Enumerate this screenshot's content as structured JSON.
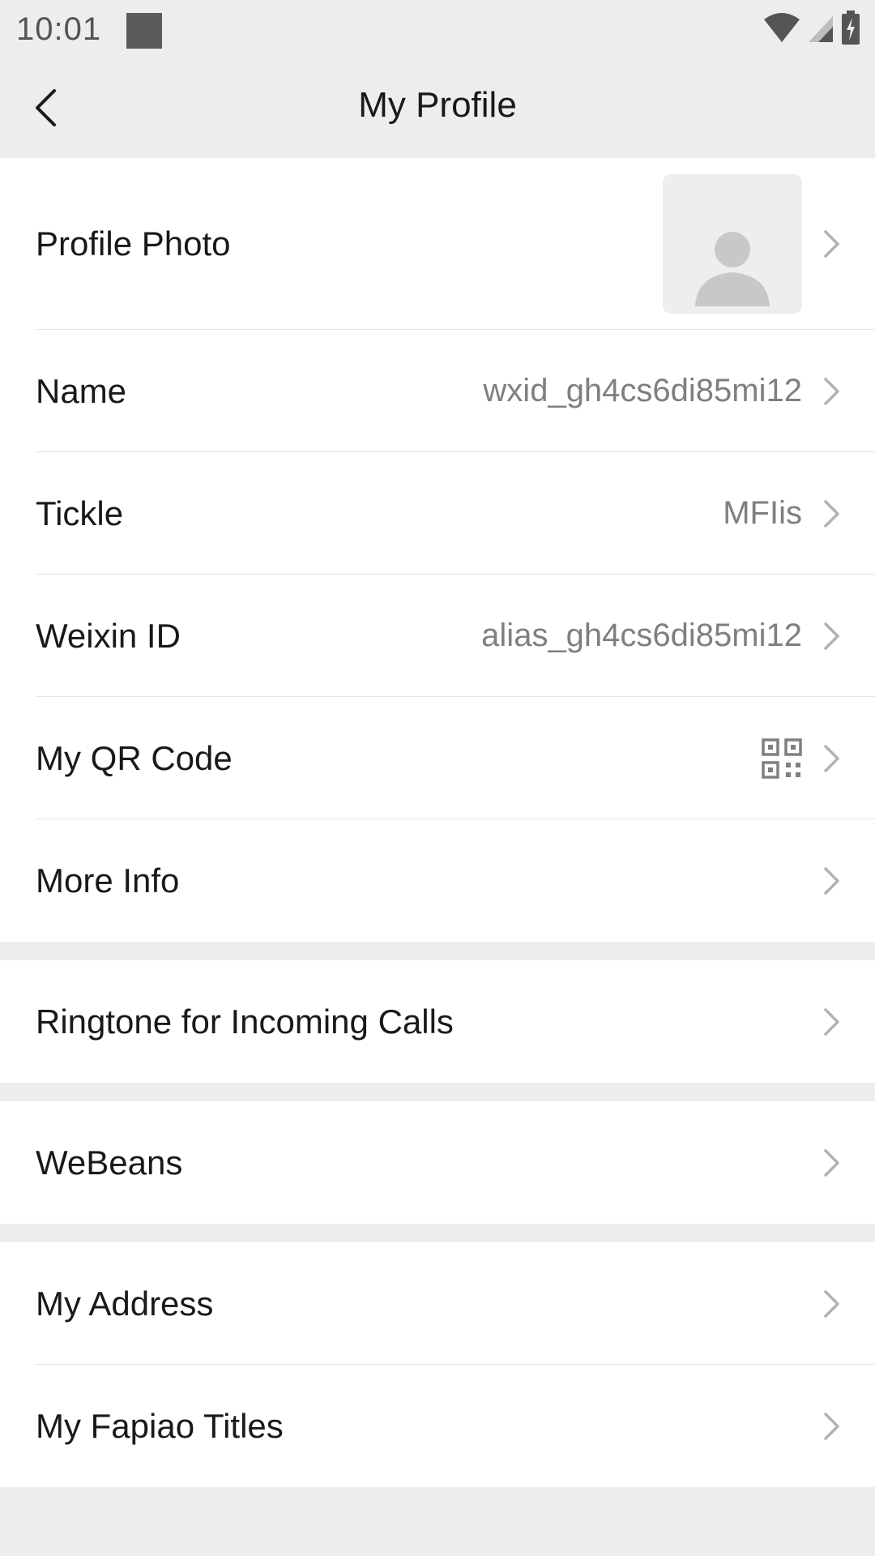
{
  "status_bar": {
    "time": "10:01",
    "icons": [
      "wifi-icon",
      "cellular-signal-icon",
      "battery-charging-icon"
    ]
  },
  "header": {
    "title": "My Profile",
    "back_icon": "chevron-left-icon"
  },
  "colors": {
    "background": "#ededed",
    "card": "#ffffff",
    "primary_text": "#191919",
    "secondary_text": "#7f7f7f",
    "chevron": "#b2b2b2"
  },
  "groups": [
    {
      "items": [
        {
          "label": "Profile Photo",
          "type": "avatar",
          "icon": "default-avatar-icon"
        },
        {
          "label": "Name",
          "value": "wxid_gh4cs6di85mi12"
        },
        {
          "label": "Tickle",
          "value": "MFIis"
        },
        {
          "label": "Weixin ID",
          "value": "alias_gh4cs6di85mi12"
        },
        {
          "label": "My QR Code",
          "type": "qr",
          "icon": "qr-code-icon"
        },
        {
          "label": "More Info"
        }
      ]
    },
    {
      "items": [
        {
          "label": "Ringtone for Incoming Calls"
        }
      ]
    },
    {
      "items": [
        {
          "label": "WeBeans"
        }
      ]
    },
    {
      "items": [
        {
          "label": "My Address"
        },
        {
          "label": "My Fapiao Titles"
        }
      ]
    }
  ]
}
